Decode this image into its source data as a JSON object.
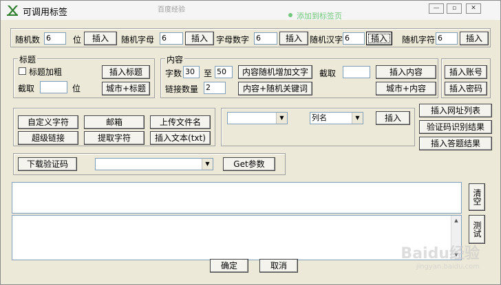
{
  "window": {
    "title": "可调用标签",
    "controls": [
      "—",
      "▫",
      "✕"
    ]
  },
  "background": {
    "ghost_text_1": "百度经验",
    "ghost_text_2": "添加到标签页"
  },
  "top_row": {
    "random_number_label": "随机数",
    "random_number_value": "6",
    "digit_label": "位",
    "insert_label": "插入",
    "random_letter_label": "随机字母",
    "random_letter_value": "6",
    "alnum_label": "字母数字",
    "alnum_value": "6",
    "random_hanzi_label": "随机汉字",
    "random_hanzi_value": "6",
    "random_char_label": "随机字符",
    "random_char_value": "6"
  },
  "title_group": {
    "legend": "标题",
    "bold_label": "标题加粗",
    "bold_checked": false,
    "insert_title_label": "插入标题",
    "truncate_label": "截取",
    "truncate_value": "",
    "digit_label": "位",
    "city_title_label": "城市+标题"
  },
  "content_group": {
    "legend": "内容",
    "char_count_label": "字数",
    "char_min": "30",
    "to_label": "至",
    "char_max": "50",
    "random_text_label": "内容随机增加文字",
    "truncate_label": "截取",
    "truncate_value": "",
    "insert_content_label": "插入内容",
    "link_count_label": "链接数量",
    "link_count_value": "2",
    "random_keyword_label": "内容+随机关键词",
    "city_content_label": "城市+内容"
  },
  "account_group": {
    "insert_account_label": "插入账号",
    "insert_password_label": "插入密码"
  },
  "misc_group": {
    "custom_char_label": "自定义字符",
    "email_label": "邮箱",
    "upload_filename_label": "上传文件名",
    "super_link_label": "超级链接",
    "extract_char_label": "提取字符",
    "insert_text_label": "插入文本(txt)"
  },
  "column_group": {
    "source_select_value": "",
    "column_select_value": "列名",
    "insert_label": "插入"
  },
  "right_buttons": {
    "insert_url_list_label": "插入网址列表",
    "captcha_result_label": "验证码识别结果",
    "insert_answer_label": "插入答题结果"
  },
  "download_group": {
    "download_captcha_label": "下载验证码",
    "param_select_value": "",
    "get_param_label": "Get参数"
  },
  "side_buttons": {
    "clear_label": "清空",
    "test_label": "测试"
  },
  "footer": {
    "ok_label": "确定",
    "cancel_label": "取消"
  },
  "watermark": {
    "brand": "Baidu经验",
    "url": "jingyan.baidu.com"
  }
}
